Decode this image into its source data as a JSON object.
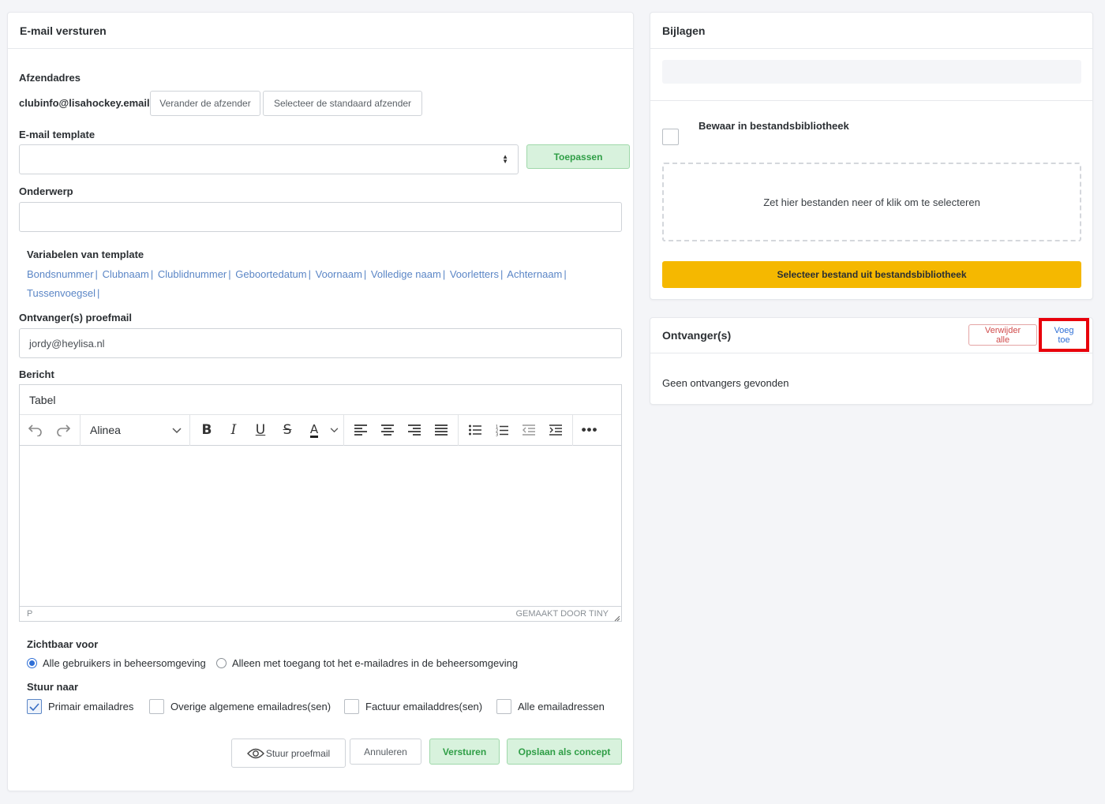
{
  "email_panel": {
    "title": "E-mail versturen",
    "sender_label": "Afzendadres",
    "sender_address": "clubinfo@lisahockey.email",
    "change_sender_button": "Verander de afzender",
    "default_sender_button": "Selecteer de standaard afzender",
    "template_label": "E-mail template",
    "template_value": "",
    "apply_button": "Toepassen",
    "subject_label": "Onderwerp",
    "subject_value": "",
    "variables_label": "Variabelen van template",
    "variables": [
      "Bondsnummer",
      "Clubnaam",
      "Clublidnummer",
      "Geboortedatum",
      "Voornaam",
      "Volledige naam",
      "Voorletters",
      "Achternaam",
      "Tussenvoegsel"
    ],
    "test_recipient_label": "Ontvanger(s) proefmail",
    "test_recipient_value": "jordy@heylisa.nl",
    "message_label": "Bericht",
    "editor": {
      "menu_item": "Tabel",
      "block_format": "Alinea",
      "status_path": "P",
      "branding": "GEMAAKT DOOR TINY"
    },
    "visible_for_label": "Zichtbaar voor",
    "visible_options": [
      "Alle gebruikers in beheersomgeving",
      "Alleen met toegang tot het e-mailadres in de beheersomgeving"
    ],
    "send_to_label": "Stuur naar",
    "send_to_options": [
      "Primair emailadres",
      "Overige algemene emailadres(sen)",
      "Factuur emailaddres(sen)",
      "Alle emailadressen"
    ],
    "actions": {
      "test_mail": "Stuur proefmail",
      "cancel": "Annuleren",
      "send": "Versturen",
      "save_draft": "Opslaan als concept"
    }
  },
  "attachments_panel": {
    "title": "Bijlagen",
    "save_library_label": "Bewaar in bestandsbibliotheek",
    "dropzone_text": "Zet hier bestanden neer of klik om te selecteren",
    "select_library_button": "Selecteer bestand uit bestandsbibliotheek"
  },
  "recipients_panel": {
    "title": "Ontvanger(s)",
    "remove_all_button": "Verwijder alle",
    "add_button": "Voeg toe",
    "empty_text": "Geen ontvangers gevonden"
  },
  "colors": {
    "accent_blue": "#5b86c6",
    "green": "#2f9e46",
    "yellow": "#f5b800",
    "highlight_red": "#e8000b"
  }
}
